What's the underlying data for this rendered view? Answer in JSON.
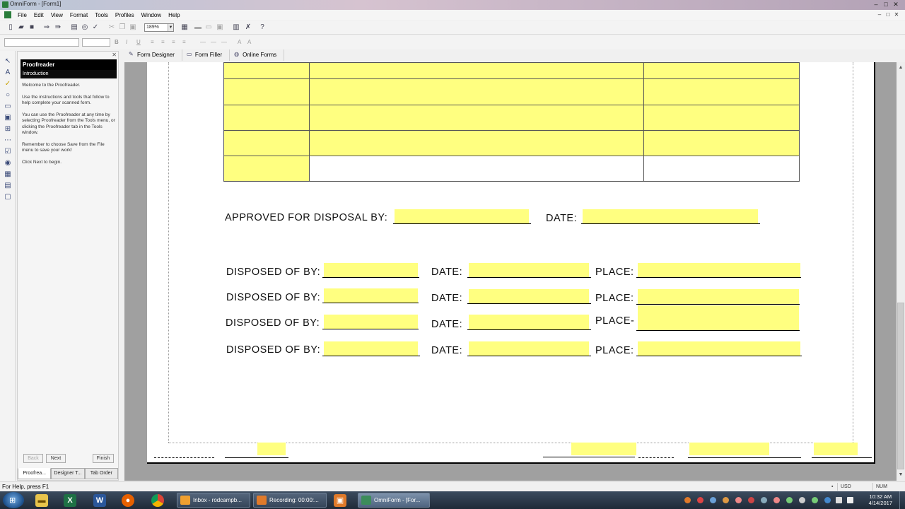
{
  "window": {
    "title": "OmniForm - [Form1]",
    "controls": [
      "–",
      "□",
      "✕"
    ]
  },
  "menu": [
    "File",
    "Edit",
    "View",
    "Format",
    "Tools",
    "Profiles",
    "Window",
    "Help"
  ],
  "toolbar": {
    "zoom": "189%"
  },
  "format_toolbar": {
    "bold": "B",
    "italic": "I",
    "underline": "U"
  },
  "proofreader": {
    "title": "Proofreader",
    "subtitle": "Introduction",
    "paragraphs": [
      "Welcome to the Proofreader.",
      "Use the instructions and tools that follow to help complete your scanned form.",
      "You can use the Proofreader at any time by selecting Proofreader from the Tools menu, or clicking the Proofreader tab in the Tools window.",
      "Remember to choose Save from the File menu to save your work!",
      "Click Next to begin."
    ],
    "buttons": {
      "back": "Back",
      "next": "Next",
      "finish": "Finish"
    },
    "tabs": [
      "Proofrea...",
      "Designer T...",
      "Tab Order"
    ]
  },
  "view_tabs": [
    "Form Designer",
    "Form Filler",
    "Online Forms"
  ],
  "form": {
    "approved_label": "APPROVED FOR DISPOSAL BY:",
    "date_label": "DATE:",
    "disposal_rows": [
      {
        "by": "DISPOSED OF BY:",
        "date": "DATE:",
        "place": "PLACE:"
      },
      {
        "by": "DISPOSED OF BY:",
        "date": "DATE:",
        "place": "PLACE:"
      },
      {
        "by": "DISPOSED OF BY:",
        "date": "DATE:",
        "place": "PLACE-"
      },
      {
        "by": "DISPOSED OF BY:",
        "date": "DATE:",
        "place": "PLACE:"
      }
    ]
  },
  "status": {
    "help": "For Help, press F1",
    "currency": "USD",
    "num": "NUM"
  },
  "taskbar": {
    "tasks": [
      "Inbox - rodcampb...",
      "Recording: 00:00:...",
      "OmniForm - [For..."
    ],
    "time": "10:32 AM",
    "date": "4/14/2017"
  },
  "colors": {
    "field_yellow": "#ffff80",
    "panel_header": "#000000"
  }
}
